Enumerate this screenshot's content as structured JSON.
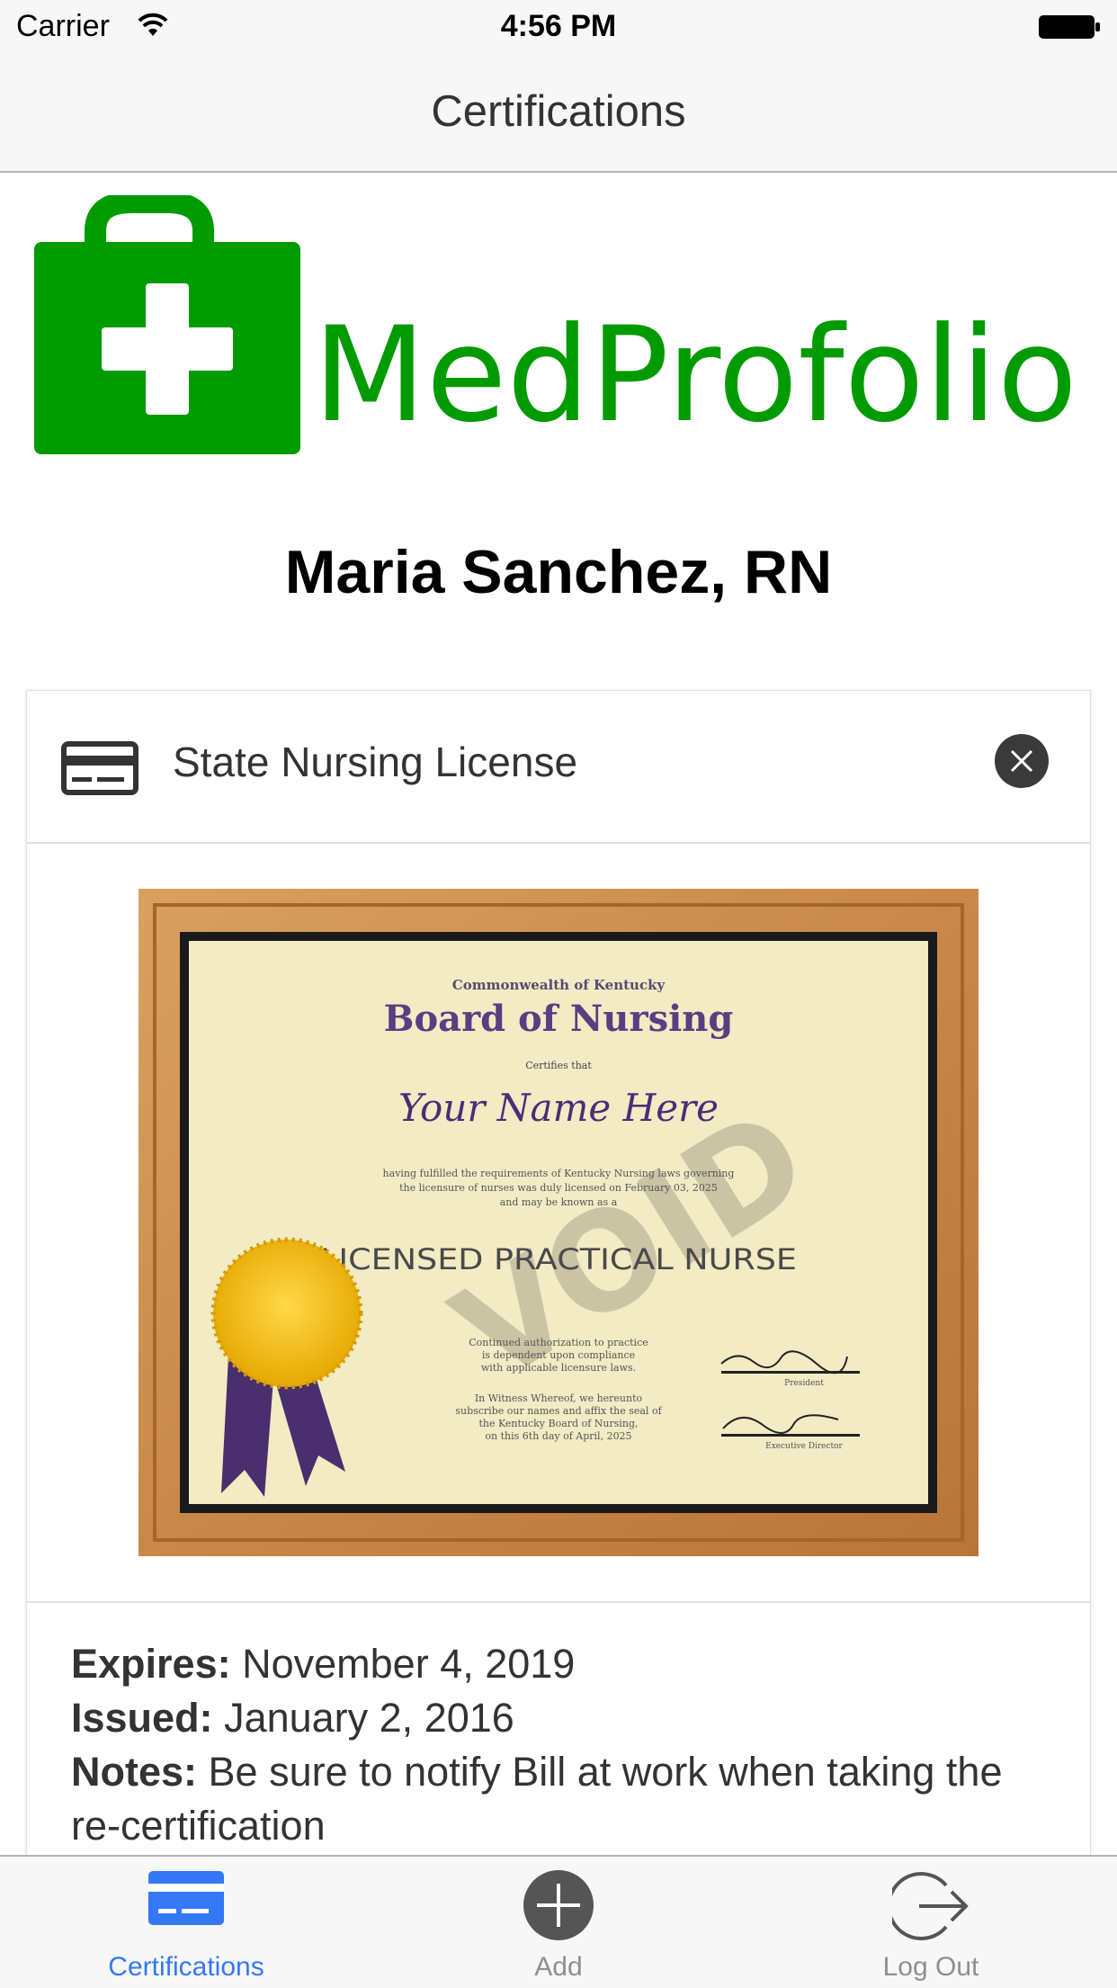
{
  "status_bar": {
    "carrier": "Carrier",
    "time": "4:56 PM"
  },
  "nav": {
    "title": "Certifications"
  },
  "logo": {
    "text": "MedProfolio",
    "color": "#009b00"
  },
  "profile": {
    "name": "Maria Sanchez, RN"
  },
  "card": {
    "title": "State Nursing License",
    "icon": "credit-card-icon",
    "image": {
      "description_text": {
        "header": "Commonwealth of Kentucky",
        "board": "Board of Nursing",
        "certifies": "Certifies that",
        "name": "Your Name Here",
        "body1": "having fulfilled the requirements of Kentucky Nursing laws governing",
        "body2": "the licensure of nurses was duly licensed on February 03, 2025",
        "body3": "and may be known as a",
        "title": "LICENSED PRACTICAL NURSE",
        "watermark": "VOID",
        "cont1": "Continued authorization to practice",
        "cont2": "is dependent upon compliance",
        "cont3": "with applicable licensure laws.",
        "wit1": "In Witness Whereof, we hereunto",
        "wit2": "subscribe our names and affix the seal of",
        "wit3": "the Kentucky Board of Nursing,",
        "wit4": "on this 6th day of April, 2025",
        "sig1": "President",
        "sig2": "Executive Director"
      }
    },
    "details": {
      "expires_label": "Expires:",
      "expires_value": "November 4, 2019",
      "issued_label": "Issued:",
      "issued_value": "January 2, 2016",
      "notes_label": "Notes:",
      "notes_value": "Be sure to notify Bill at work when taking the re-certification"
    }
  },
  "tab_bar": {
    "tabs": [
      {
        "label": "Certifications",
        "icon": "credit-card-icon",
        "active": true
      },
      {
        "label": "Add",
        "icon": "plus-circle-icon",
        "active": false
      },
      {
        "label": "Log Out",
        "icon": "logout-icon",
        "active": false
      }
    ],
    "active_color": "#3478f6",
    "inactive_color": "#8e8e93"
  }
}
